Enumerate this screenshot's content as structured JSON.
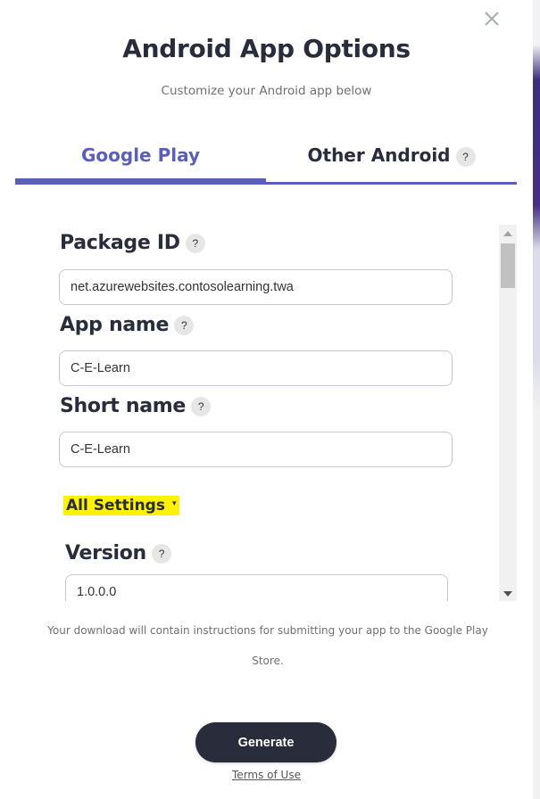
{
  "dialog": {
    "title": "Android App Options",
    "subtitle": "Customize your Android app below",
    "close_icon": "close-icon"
  },
  "tabs": [
    {
      "label": "Google Play",
      "active": true,
      "has_help": false
    },
    {
      "label": "Other Android",
      "active": false,
      "has_help": true,
      "help_glyph": "?"
    }
  ],
  "form": {
    "fields": [
      {
        "label": "Package ID",
        "help_glyph": "?",
        "value": "net.azurewebsites.contosolearning.twa"
      },
      {
        "label": "App name",
        "help_glyph": "?",
        "value": "C-E-Learn"
      },
      {
        "label": "Short name",
        "help_glyph": "?",
        "value": "C-E-Learn"
      }
    ],
    "all_settings": {
      "label": "All Settings",
      "caret": "▾",
      "highlight_color": "#fff200"
    },
    "version": {
      "label": "Version",
      "help_glyph": "?",
      "value": "1.0.0.0"
    }
  },
  "footer": {
    "note": "Your download will contain instructions for submitting your app to the Google Play Store.",
    "generate_label": "Generate",
    "terms_label": "Terms of Use"
  },
  "colors": {
    "accent": "#5b5fb8",
    "dark": "#292c3a",
    "highlight": "#fff200"
  }
}
